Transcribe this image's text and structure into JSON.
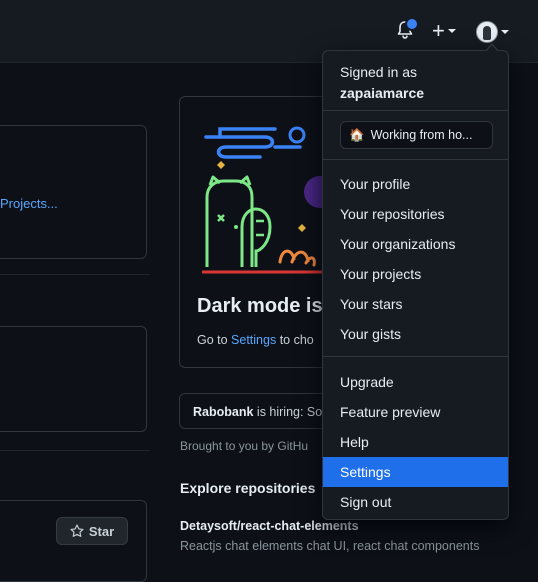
{
  "colors": {
    "background": "#0d1117",
    "header": "#161b22",
    "accent": "#1f6feb",
    "link": "#58a6ff",
    "notification_dot": "#3b82f6"
  },
  "header": {
    "icons": [
      "bell-icon",
      "plus-icon",
      "caret-down-icon",
      "avatar"
    ],
    "plus_label": "+"
  },
  "left": {
    "projects_link": "Projects...",
    "star_button_label": "Star"
  },
  "dark_mode_card": {
    "title": "Dark mode is",
    "text_prefix": "Go to ",
    "settings_link": "Settings",
    "text_suffix": " to cho"
  },
  "feed": {
    "hiring_company": "Rabobank",
    "hiring_text": " is hiring: So",
    "brought_by": "Brought to you by GitHu",
    "explore_title": "Explore repositories",
    "repo_name": "Detaysoft/react-chat-elements",
    "repo_description": "Reactjs chat elements chat UI, react chat components"
  },
  "user_menu": {
    "signed_in_as": "Signed in as",
    "username": "zapaiamarce",
    "status_emoji": "🏠",
    "status_text": "Working from ho...",
    "items_group1": [
      {
        "label": "Your profile"
      },
      {
        "label": "Your repositories"
      },
      {
        "label": "Your organizations"
      },
      {
        "label": "Your projects"
      },
      {
        "label": "Your stars"
      },
      {
        "label": "Your gists"
      }
    ],
    "items_group2": [
      {
        "label": "Upgrade"
      },
      {
        "label": "Feature preview"
      },
      {
        "label": "Help"
      },
      {
        "label": "Settings",
        "active": true
      },
      {
        "label": "Sign out"
      }
    ]
  }
}
